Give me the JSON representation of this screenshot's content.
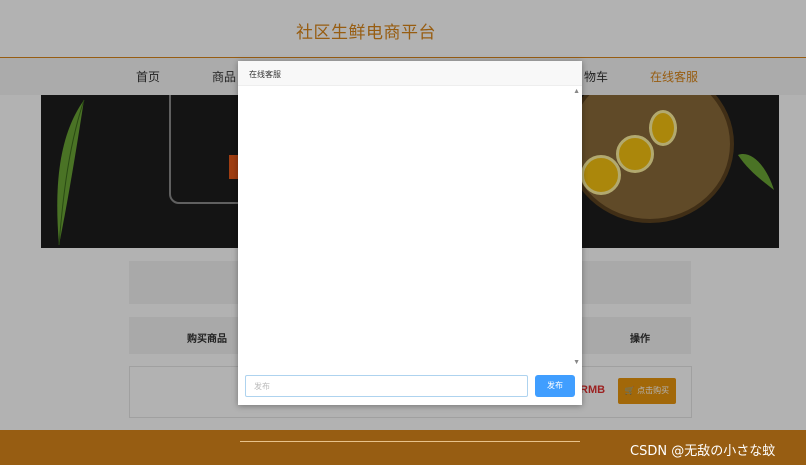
{
  "header": {
    "site_title": "社区生鲜电商平台"
  },
  "nav": {
    "items": [
      {
        "label": "首页"
      },
      {
        "label": "商品"
      },
      {
        "label": "物车"
      },
      {
        "label": "在线客服"
      }
    ]
  },
  "cart": {
    "columns": {
      "goods": "购买商品",
      "operations": "操作"
    },
    "row": {
      "price_fragment": "RMB",
      "buy_label": "点击购买"
    }
  },
  "dialog": {
    "title": "在线客服",
    "input_placeholder": "发布",
    "send_label": "发布"
  },
  "watermark": "CSDN @无敌の小さな蚊",
  "colors": {
    "brand": "#d9861a",
    "primary": "#409eff",
    "price": "#e03030"
  }
}
